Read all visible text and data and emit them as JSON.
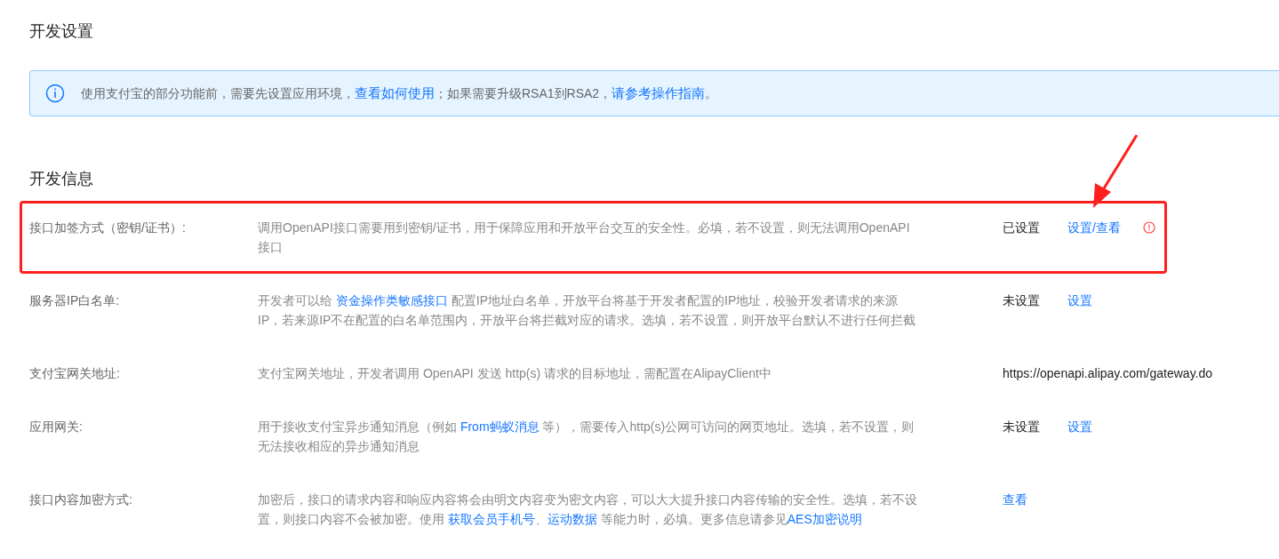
{
  "section_title": "开发设置",
  "notice": {
    "segments": [
      {
        "text": "使用支付宝的部分功能前，需要先设置应用环境，",
        "link": false
      },
      {
        "text": "查看如何使用",
        "link": true
      },
      {
        "text": "；如果需要升级RSA1到RSA2，",
        "link": false
      },
      {
        "text": "请参考操作指南",
        "link": true
      },
      {
        "text": "。",
        "link": false
      }
    ]
  },
  "info_title": "开发信息",
  "rows": [
    {
      "label": "接口加签方式（密钥/证书）:",
      "highlighted": true,
      "warning": true,
      "description": [
        {
          "text": "调用OpenAPI接口需要用到密钥/证书，用于保障应用和开放平台交互的安全性。必填，若不设置，则无法调用OpenAPI接口",
          "link": false
        }
      ],
      "cells": [
        {
          "kind": "text",
          "text": "已设置"
        },
        {
          "kind": "link",
          "text": "设置/查看"
        }
      ]
    },
    {
      "label": "服务器IP白名单:",
      "highlighted": false,
      "warning": false,
      "description": [
        {
          "text": "开发者可以给 ",
          "link": false
        },
        {
          "text": "资金操作类敏感接口",
          "link": true
        },
        {
          "text": " 配置IP地址白名单，开放平台将基于开发者配置的IP地址，校验开发者请求的来源IP，若来源IP不在配置的白名单范围内，开放平台将拦截对应的请求。选填，若不设置，则开放平台默认不进行任何拦截",
          "link": false
        }
      ],
      "cells": [
        {
          "kind": "text",
          "text": "未设置"
        },
        {
          "kind": "link",
          "text": "设置"
        }
      ]
    },
    {
      "label": "支付宝网关地址:",
      "highlighted": false,
      "warning": false,
      "description": [
        {
          "text": "支付宝网关地址，开发者调用 OpenAPI 发送 http(s) 请求的目标地址，需配置在AlipayClient中",
          "link": false
        }
      ],
      "cells": [
        {
          "kind": "text",
          "text": "https://openapi.alipay.com/gateway.do"
        }
      ]
    },
    {
      "label": "应用网关:",
      "highlighted": false,
      "warning": false,
      "description": [
        {
          "text": "用于接收支付宝异步通知消息（例如 ",
          "link": false
        },
        {
          "text": "From蚂蚁消息",
          "link": true
        },
        {
          "text": " 等），需要传入http(s)公网可访问的网页地址。选填，若不设置，则无法接收相应的异步通知消息",
          "link": false
        }
      ],
      "cells": [
        {
          "kind": "text",
          "text": "未设置"
        },
        {
          "kind": "link",
          "text": "设置"
        }
      ]
    },
    {
      "label": "接口内容加密方式:",
      "highlighted": false,
      "warning": false,
      "description": [
        {
          "text": "加密后，接口的请求内容和响应内容将会由明文内容变为密文内容，可以大大提升接口内容传输的安全性。选填，若不设置，则接口内容不会被加密。使用 ",
          "link": false
        },
        {
          "text": "获取会员手机号",
          "link": true
        },
        {
          "text": "、",
          "link": false
        },
        {
          "text": "运动数据",
          "link": true
        },
        {
          "text": " 等能力时，必填。更多信息请参见",
          "link": false
        },
        {
          "text": "AES加密说明",
          "link": true
        }
      ],
      "cells": [
        {
          "kind": "link",
          "text": "查看"
        }
      ]
    }
  ]
}
